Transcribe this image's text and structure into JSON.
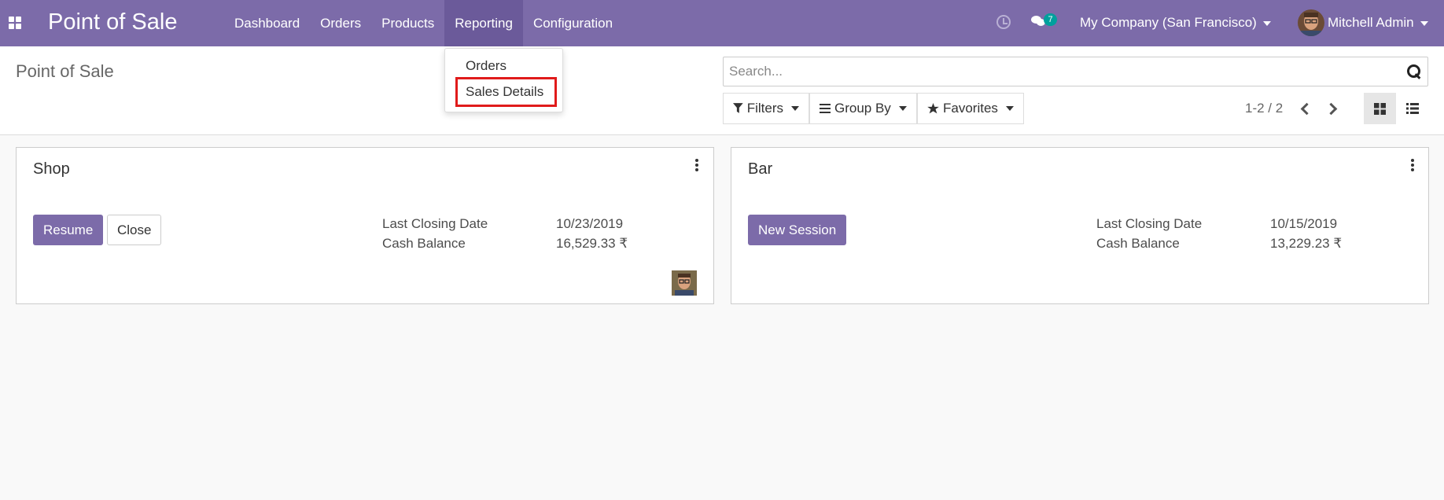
{
  "navbar": {
    "app_title": "Point of Sale",
    "menu": [
      "Dashboard",
      "Orders",
      "Products",
      "Reporting",
      "Configuration"
    ],
    "active_menu": "Reporting",
    "message_count": "7",
    "company": "My Company (San Francisco)",
    "user": "Mitchell Admin",
    "color": "#7c6ba9"
  },
  "reporting_dropdown": {
    "items": [
      "Orders",
      "Sales Details"
    ],
    "highlighted": "Sales Details"
  },
  "control_panel": {
    "breadcrumb": "Point of Sale",
    "search_placeholder": "Search...",
    "filters_label": "Filters",
    "group_by_label": "Group By",
    "favorites_label": "Favorites",
    "pager": "1-2 / 2"
  },
  "cards": [
    {
      "name": "Shop",
      "primary_button": "Resume",
      "secondary_button": "Close",
      "last_closing_label": "Last Closing Date",
      "last_closing_date": "10/23/2019",
      "cash_balance_label": "Cash Balance",
      "cash_balance": "16,529.33 ₹"
    },
    {
      "name": "Bar",
      "primary_button": "New Session",
      "last_closing_label": "Last Closing Date",
      "last_closing_date": "10/15/2019",
      "cash_balance_label": "Cash Balance",
      "cash_balance": "13,229.23 ₹"
    }
  ],
  "colors": {
    "primary": "#7c6ba9",
    "badge": "#00a09d",
    "highlight": "#e01b1b"
  }
}
